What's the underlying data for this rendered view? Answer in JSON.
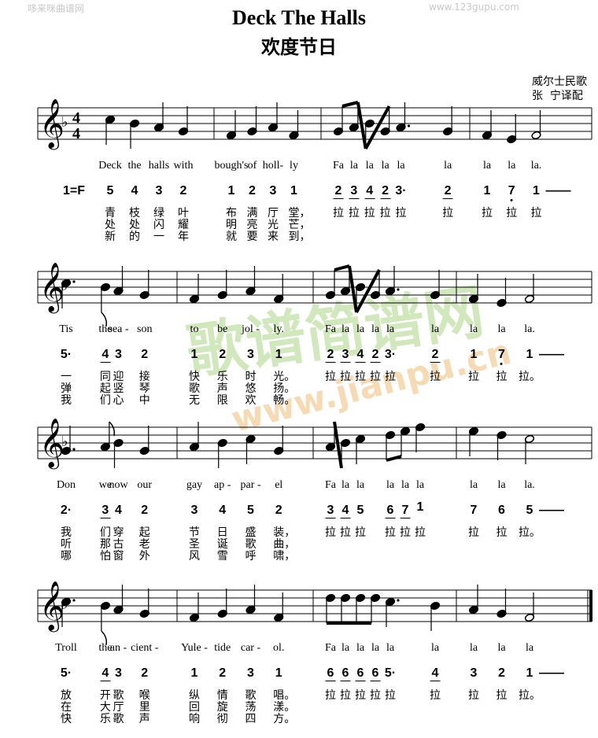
{
  "watermarks": {
    "top_left": "哆来咪曲谱网",
    "top_right": "www.123gupu.com",
    "center_logo": "歌谱简谱网",
    "center_url": "www.jianpu.cn"
  },
  "title": "Deck The Halls",
  "subtitle": "欢度节日",
  "composer": "威尔士民歌",
  "arranger": "张  宁译配",
  "key_signature": "1=F",
  "time_signature": {
    "top": "4",
    "bottom": "4"
  },
  "systems": [
    {
      "measures": [
        [
          {
            "d": "5",
            "dur": "q"
          },
          {
            "d": "4",
            "dur": "q"
          },
          {
            "d": "3",
            "dur": "q"
          },
          {
            "d": "2",
            "dur": "q"
          }
        ],
        [
          {
            "d": "1",
            "dur": "q"
          },
          {
            "d": "2",
            "dur": "q"
          },
          {
            "d": "3",
            "dur": "q"
          },
          {
            "d": "1",
            "dur": "q"
          }
        ],
        [
          {
            "d": "2",
            "dur": "e"
          },
          {
            "d": "3",
            "dur": "e"
          },
          {
            "d": "4",
            "dur": "e"
          },
          {
            "d": "2",
            "dur": "e"
          },
          {
            "d": "3",
            "dur": "dq"
          },
          {
            "d": "2",
            "dur": "e"
          }
        ],
        [
          {
            "d": "1",
            "dur": "q"
          },
          {
            "d": "7",
            "oct": -1,
            "dur": "q"
          },
          {
            "d": "1",
            "dur": "h"
          }
        ]
      ],
      "english": [
        "Deck",
        "the",
        "halls",
        "with",
        "bough's",
        "of",
        "holl-",
        "ly",
        "Fa",
        "la",
        "la",
        "la",
        "la",
        "la",
        "la",
        "la",
        "la."
      ],
      "chinese": [
        "青枝绿叶布满厅堂，",
        "处处闪耀明亮光芒，",
        "新的一年就要来到，"
      ],
      "fala": [
        "拉",
        "拉",
        "拉",
        "拉",
        "拉",
        "拉",
        "拉",
        "拉",
        "拉"
      ]
    },
    {
      "measures": [
        [
          {
            "d": "5",
            "dur": "dq"
          },
          {
            "d": "4",
            "dur": "e"
          },
          {
            "d": "3",
            "dur": "q"
          },
          {
            "d": "2",
            "dur": "q"
          }
        ],
        [
          {
            "d": "1",
            "dur": "q"
          },
          {
            "d": "2",
            "dur": "q"
          },
          {
            "d": "3",
            "dur": "q"
          },
          {
            "d": "1",
            "dur": "q"
          }
        ],
        [
          {
            "d": "2",
            "dur": "e"
          },
          {
            "d": "3",
            "dur": "e"
          },
          {
            "d": "4",
            "dur": "e"
          },
          {
            "d": "2",
            "dur": "e"
          },
          {
            "d": "3",
            "dur": "dq"
          },
          {
            "d": "2",
            "dur": "e"
          }
        ],
        [
          {
            "d": "1",
            "dur": "q"
          },
          {
            "d": "7",
            "oct": -1,
            "dur": "q"
          },
          {
            "d": "1",
            "dur": "h"
          }
        ]
      ],
      "english": [
        "Tis",
        "the",
        "sea -",
        "son",
        "to",
        "be",
        "jol -",
        "ly.",
        "Fa",
        "la",
        "la",
        "la",
        "la",
        "la",
        "la",
        "la",
        "la."
      ],
      "chinese": [
        "一同迎接快乐时光。",
        "弹起竖琴歌声悠扬。",
        "我们心中无限欢畅。"
      ],
      "fala": [
        "拉",
        "拉",
        "拉",
        "拉",
        "拉",
        "拉",
        "拉",
        "拉",
        "拉。"
      ]
    },
    {
      "measures": [
        [
          {
            "d": "2",
            "dur": "dq"
          },
          {
            "d": "3",
            "dur": "e"
          },
          {
            "d": "4",
            "dur": "q"
          },
          {
            "d": "2",
            "dur": "q"
          }
        ],
        [
          {
            "d": "3",
            "dur": "q"
          },
          {
            "d": "4",
            "dur": "q"
          },
          {
            "d": "5",
            "dur": "q"
          },
          {
            "d": "2",
            "dur": "q"
          }
        ],
        [
          {
            "d": "3",
            "dur": "e"
          },
          {
            "d": "4",
            "dur": "e"
          },
          {
            "d": "5",
            "dur": "q"
          },
          {
            "d": "6",
            "dur": "e"
          },
          {
            "d": "7",
            "dur": "e"
          },
          {
            "d": "1",
            "oct": 1,
            "dur": "q"
          }
        ],
        [
          {
            "d": "7",
            "dur": "q"
          },
          {
            "d": "6",
            "dur": "q"
          },
          {
            "d": "5",
            "dur": "h"
          }
        ]
      ],
      "english": [
        "Don",
        "we",
        "now",
        "our",
        "gay",
        "ap -",
        "par -",
        "el",
        "Fa",
        "la",
        "la",
        "la",
        "la",
        "la",
        "la",
        "la",
        "la."
      ],
      "chinese": [
        "我们穿起节日盛装，",
        "听那古老圣诞歌曲，",
        "哪怕窗外风雪呼啸，"
      ],
      "fala": [
        "拉",
        "拉",
        "拉",
        "拉",
        "拉",
        "拉",
        "拉",
        "拉",
        "拉。"
      ]
    },
    {
      "measures": [
        [
          {
            "d": "5",
            "dur": "dq"
          },
          {
            "d": "4",
            "dur": "e"
          },
          {
            "d": "3",
            "dur": "q"
          },
          {
            "d": "2",
            "dur": "q"
          }
        ],
        [
          {
            "d": "1",
            "dur": "q"
          },
          {
            "d": "2",
            "dur": "q"
          },
          {
            "d": "3",
            "dur": "q"
          },
          {
            "d": "1",
            "dur": "q"
          }
        ],
        [
          {
            "d": "6",
            "dur": "e"
          },
          {
            "d": "6",
            "dur": "e"
          },
          {
            "d": "6",
            "dur": "e"
          },
          {
            "d": "6",
            "dur": "e"
          },
          {
            "d": "5",
            "dur": "dq"
          },
          {
            "d": "4",
            "dur": "e"
          }
        ],
        [
          {
            "d": "3",
            "dur": "q"
          },
          {
            "d": "2",
            "dur": "q"
          },
          {
            "d": "1",
            "dur": "h"
          }
        ]
      ],
      "english": [
        "Troll",
        "the",
        "an -",
        "cient -",
        "Yule -",
        "tide",
        "car -",
        "ol.",
        "Fa",
        "la",
        "la",
        "la",
        "la",
        "la",
        "la",
        "la",
        "la"
      ],
      "chinese": [
        "放开歌喉纵情歌唱。",
        "在大厅里回旋荡漾。",
        "快乐歌声响彻四方。"
      ],
      "fala": [
        "拉",
        "拉",
        "拉",
        "拉",
        "拉",
        "拉",
        "拉",
        "拉",
        "拉。"
      ]
    }
  ]
}
